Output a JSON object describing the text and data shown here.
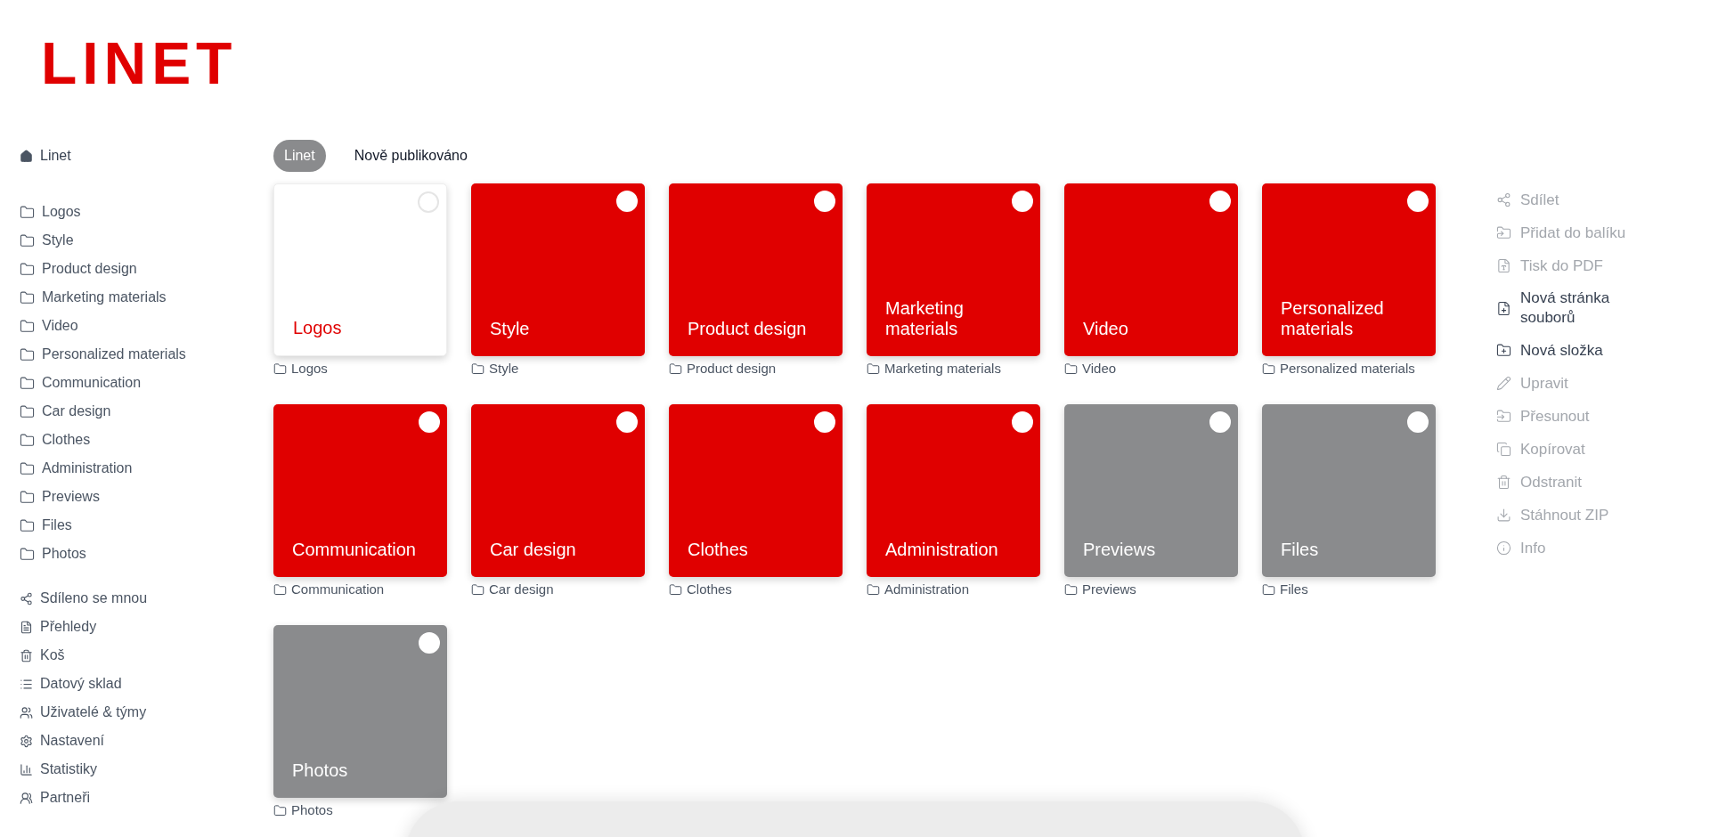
{
  "logo": "LINET",
  "sidebar": {
    "home": "Linet",
    "folders": [
      "Logos",
      "Style",
      "Product design",
      "Marketing materials",
      "Video",
      "Personalized materials",
      "Communication",
      "Car design",
      "Clothes",
      "Administration",
      "Previews",
      "Files",
      "Photos"
    ],
    "tools": [
      "Sdíleno se mnou",
      "Přehledy",
      "Koš",
      "Datový sklad",
      "Uživatelé & týmy",
      "Nastavení",
      "Statistiky",
      "Partneři"
    ]
  },
  "tabs": [
    {
      "label": "Linet",
      "selected": true
    },
    {
      "label": "Nově publikováno",
      "selected": false
    }
  ],
  "tiles": [
    {
      "title": "Logos",
      "caption": "Logos",
      "kind": "outlined",
      "color": "#ffffff",
      "checked": false
    },
    {
      "title": "Style",
      "caption": "Style",
      "kind": "filled",
      "color": "#e00000",
      "checked": false
    },
    {
      "title": "Product design",
      "caption": "Product design",
      "kind": "filled",
      "color": "#e00000",
      "checked": false
    },
    {
      "title": "Marketing materials",
      "caption": "Marketing materials",
      "kind": "filled",
      "color": "#e00000",
      "checked": false
    },
    {
      "title": "Video",
      "caption": "Video",
      "kind": "filled",
      "color": "#e00000",
      "checked": false
    },
    {
      "title": "Personalized materials",
      "caption": "Personalized materials",
      "kind": "filled",
      "color": "#e00000",
      "checked": false
    },
    {
      "title": "Communication",
      "caption": "Communication",
      "kind": "filled",
      "color": "#e00000",
      "checked": false
    },
    {
      "title": "Car design",
      "caption": "Car design",
      "kind": "filled",
      "color": "#e00000",
      "checked": false
    },
    {
      "title": "Clothes",
      "caption": "Clothes",
      "kind": "filled",
      "color": "#e00000",
      "checked": false
    },
    {
      "title": "Administration",
      "caption": "Administration",
      "kind": "filled",
      "color": "#e00000",
      "checked": false
    },
    {
      "title": "Previews",
      "caption": "Previews",
      "kind": "filled",
      "color": "#8a8b8d",
      "checked": false
    },
    {
      "title": "Files",
      "caption": "Files",
      "kind": "filled",
      "color": "#8a8b8d",
      "checked": false
    },
    {
      "title": "Photos",
      "caption": "Photos",
      "kind": "filled",
      "color": "#8a8b8d",
      "checked": false
    }
  ],
  "actions": [
    {
      "label": "Sdílet",
      "disabled": true
    },
    {
      "label": "Přidat do balíku",
      "disabled": true
    },
    {
      "label": "Tisk do PDF",
      "disabled": true
    },
    {
      "label": "Nová stránka souborů",
      "disabled": false
    },
    {
      "label": "Nová složka",
      "disabled": false
    },
    {
      "label": "Upravit",
      "disabled": true
    },
    {
      "label": "Přesunout",
      "disabled": true
    },
    {
      "label": "Kopírovat",
      "disabled": true
    },
    {
      "label": "Odstranit",
      "disabled": true
    },
    {
      "label": "Stáhnout ZIP",
      "disabled": true
    },
    {
      "label": "Info",
      "disabled": true
    }
  ]
}
